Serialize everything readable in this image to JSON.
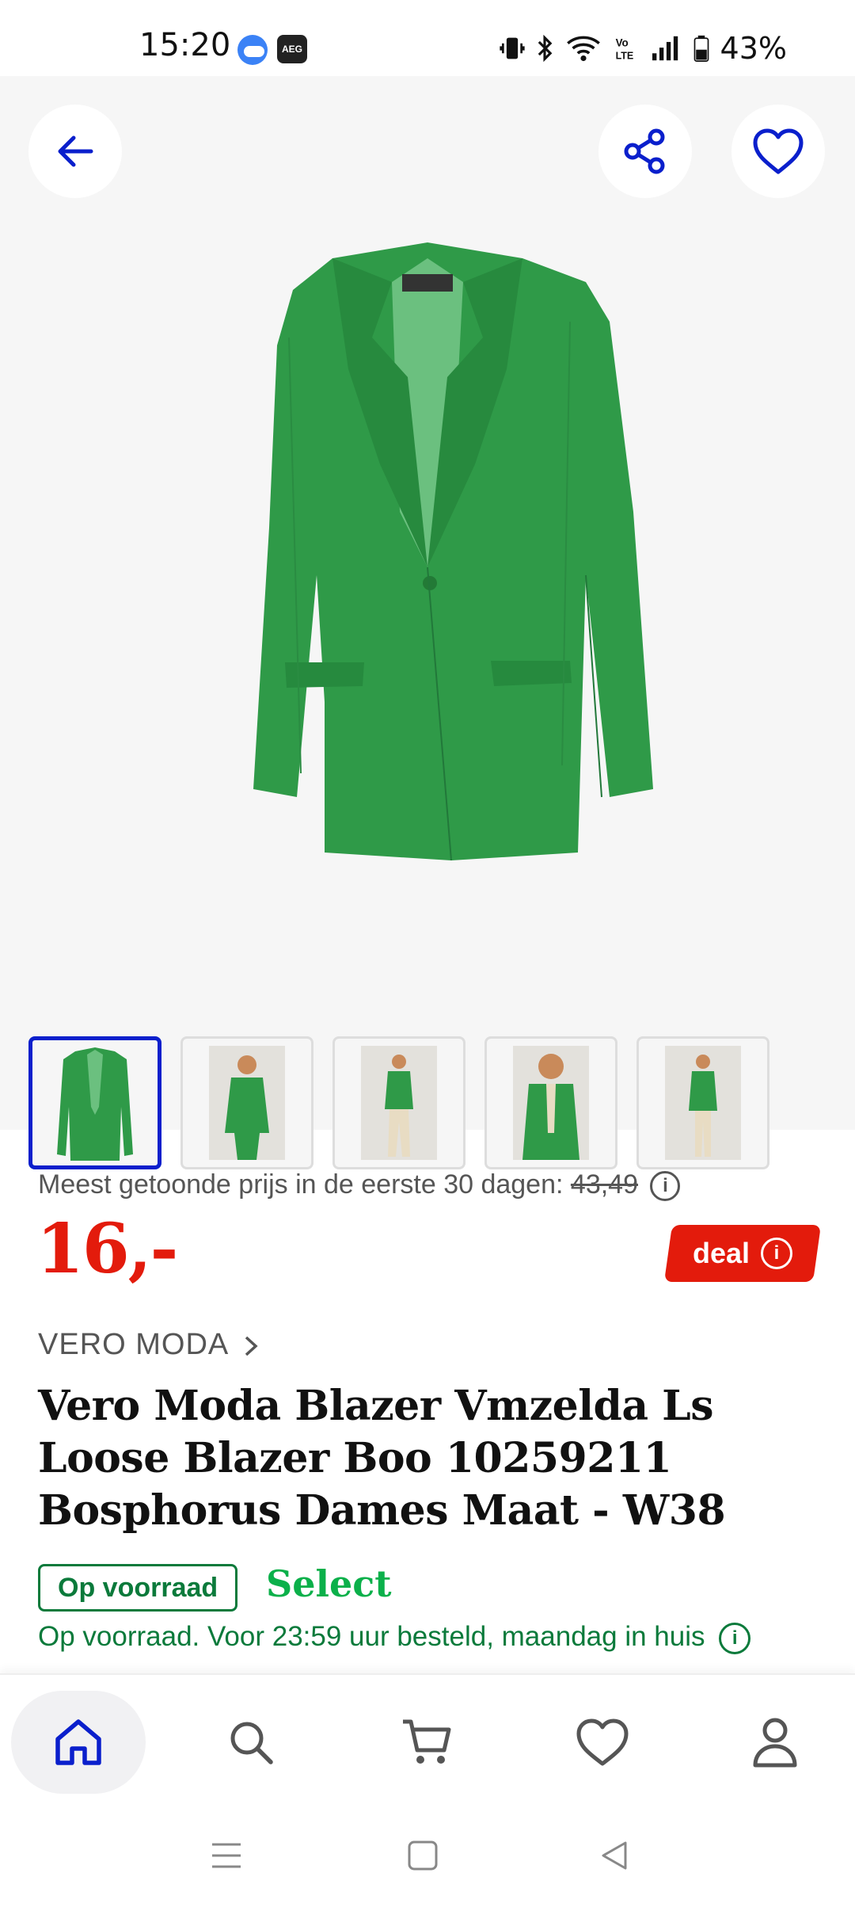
{
  "status_bar": {
    "time": "15:20",
    "battery": "43%",
    "icons": [
      "weather-icon",
      "aeg-app-icon",
      "vibrate-icon",
      "bluetooth-icon",
      "wifi-icon",
      "volte-icon",
      "signal-icon",
      "battery-icon"
    ]
  },
  "gallery": {
    "back_icon": "arrow-left-icon",
    "share_icon": "share-icon",
    "favorite_icon": "heart-icon",
    "thumbnail_count": 5,
    "active_thumbnail": 1
  },
  "pricing": {
    "lowest_label": "Meest getoonde prijs in de eerste 30 dagen:",
    "lowest_price": "43,49",
    "price": "16,-",
    "deal_label": "deal"
  },
  "product": {
    "brand": "VERO MODA",
    "title": "Vero Moda Blazer Vmzelda Ls Loose Blazer Boo 10259211 Bosphorus Dames Maat - W38",
    "stock_badge": "Op voorraad",
    "select_label": "Select",
    "delivery_text": "Op voorraad. Voor 23:59 uur besteld, maandag in huis"
  },
  "bottom_nav": {
    "items": [
      "home-icon",
      "search-icon",
      "cart-icon",
      "wishlist-icon",
      "account-icon"
    ],
    "active": "home-icon"
  },
  "colors": {
    "accent_blue": "#0a1fcc",
    "price_red": "#e31b0c",
    "stock_green": "#0b7a3b",
    "select_green": "#0bb04a",
    "blazer_green": "#2f9a48"
  }
}
